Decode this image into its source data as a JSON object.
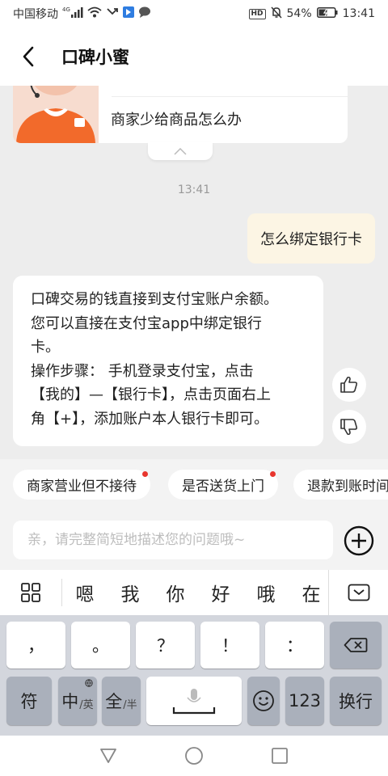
{
  "status_bar": {
    "carrier": "中国移动",
    "network": "4G",
    "battery": "54%",
    "time": "13:41",
    "hd": "HD"
  },
  "header": {
    "title": "口碑小蜜",
    "back_icon": "chevron-left-icon"
  },
  "chat": {
    "card_text": "商家少给商品怎么办",
    "timestamp": "13:41",
    "user_message": "怎么绑定银行卡",
    "bot_message": "口碑交易的钱直接到支付宝账户余额。\n您可以直接在支付宝app中绑定银行\n卡。\n操作步骤： 手机登录支付宝，点击\n【我的】—【银行卡】，点击页面右上\n角【+】，添加账户本人银行卡即可。",
    "feedback_icons": [
      "thumbs-up-icon",
      "thumbs-down-icon"
    ]
  },
  "suggestions": [
    {
      "label": "商家营业但不接待",
      "dot": true
    },
    {
      "label": "是否送货上门",
      "dot": true
    },
    {
      "label": "退款到账时间",
      "dot": false
    }
  ],
  "input": {
    "placeholder": "亲，请完整简短地描述您的问题哦~",
    "value": ""
  },
  "ime": {
    "candidates": [
      "嗯",
      "我",
      "你",
      "好",
      "哦",
      "在"
    ]
  },
  "keyboard": {
    "row1": [
      "，",
      "。",
      "？",
      "！",
      "：",
      "⌫"
    ],
    "row2": {
      "symbol": "符",
      "lang_main": "中",
      "lang_sub": "/英",
      "width_main": "全",
      "width_sub": "/半",
      "numbers": "123",
      "enter": "换行"
    }
  },
  "colors": {
    "user_bubble": "#fcf5e4",
    "notification_dot": "#e8352e",
    "keyboard_bg": "#d3d6dd"
  }
}
